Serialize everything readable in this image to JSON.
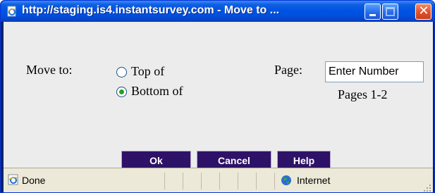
{
  "window": {
    "title": "http://staging.is4.instantsurvey.com - Move to ...",
    "controls": [
      "minimize",
      "maximize",
      "close"
    ]
  },
  "dialog": {
    "move_to_label": "Move to:",
    "options": [
      {
        "label": "Top of",
        "selected": false
      },
      {
        "label": "Bottom of",
        "selected": true
      }
    ],
    "page_label": "Page:",
    "page_input": {
      "value": "Enter Number"
    },
    "pages_range": "Pages 1-2",
    "buttons": {
      "ok": "Ok",
      "cancel": "Cancel",
      "help": "Help"
    }
  },
  "statusbar": {
    "status": "Done",
    "zone": "Internet"
  },
  "colors": {
    "button_bg": "#2e1267",
    "title_blue": "#0054e3",
    "client_bg": "#ececec"
  }
}
